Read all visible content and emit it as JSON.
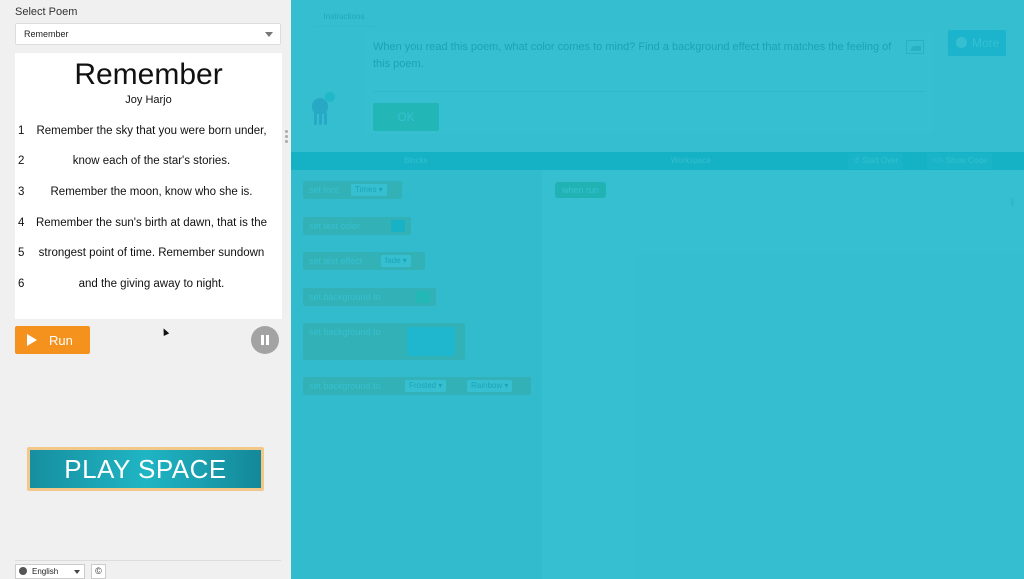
{
  "select_poem": {
    "label": "Select Poem",
    "value": "Remember"
  },
  "poem": {
    "title": "Remember",
    "author": "Joy Harjo",
    "lines": [
      {
        "num": "1",
        "text": "Remember the sky that you were born under,"
      },
      {
        "num": "2",
        "text": "know each of the star's stories."
      },
      {
        "num": "3",
        "text": "Remember the moon, know who she is."
      },
      {
        "num": "4",
        "text": "Remember the sun's birth at dawn, that is the"
      },
      {
        "num": "5",
        "text": "strongest point of time. Remember sundown"
      },
      {
        "num": "6",
        "text": "and the giving away to night."
      }
    ]
  },
  "controls": {
    "run_label": "Run"
  },
  "banner": {
    "text": "PLAY SPACE"
  },
  "footer": {
    "language": "English",
    "copyright_glyph": "©"
  },
  "instructions": {
    "tab_label": "Instructions",
    "text": "When you read this poem, what color comes to mind? Find a background effect that matches the feeling of this poem.",
    "ok_label": "OK",
    "more_label": "More"
  },
  "toolbar": {
    "blocks_label": "Blocks",
    "workspace_label": "Workspace",
    "start_over_label": "Start Over",
    "show_code_label": "Show Code"
  },
  "blocks": {
    "set_font": "set font",
    "font_value": "Times ▾",
    "set_text_color": "set text color",
    "set_text_effect": "set text effect",
    "effect_value": "fade ▾",
    "set_background_to": "set background to",
    "set_background_to_2": "set background to",
    "set_background_to_3": "set background to",
    "frosted_value": "Frosted ▾",
    "rainbow_value": "Rainbow ▾",
    "text_color_swatch": "#2aa1b2",
    "bg_swatch": "#7ac943"
  },
  "workspace": {
    "when_run": "when run"
  },
  "colors": {
    "run_orange": "#f5921e",
    "overlay_teal": "#14b4c8",
    "ok_green": "#78c848",
    "block_orange": "#e79f4f"
  }
}
